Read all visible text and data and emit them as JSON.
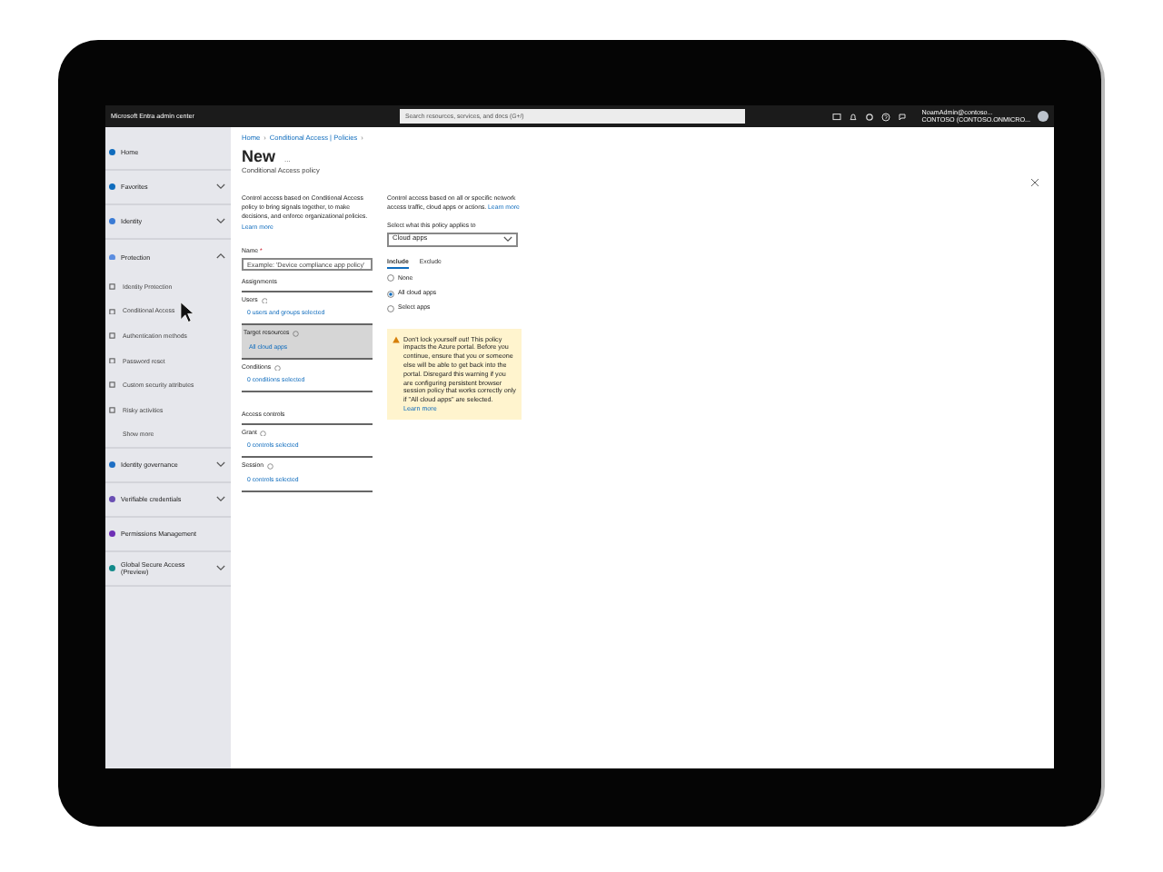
{
  "top_bar": {
    "title": "Microsoft Entra admin center",
    "search": {
      "placeholder": "Search resources, services, and docs (G+/)"
    },
    "user": {
      "name": "NoamAdmin@contoso...",
      "tenant": "CONTOSO (CONTOSO.ONMICRO..."
    }
  },
  "sidebar": {
    "items": [
      {
        "label": "Home",
        "kind": "link"
      },
      {
        "label": "Favorites",
        "kind": "group",
        "expanded": false
      },
      {
        "label": "Identity",
        "kind": "group",
        "expanded": false
      },
      {
        "label": "Protection",
        "kind": "group",
        "expanded": true,
        "children": [
          {
            "label": "Identity Protection",
            "kind": "link"
          },
          {
            "label": "Conditional Access",
            "kind": "link"
          },
          {
            "label": "Authentication methods",
            "kind": "link"
          },
          {
            "label": "Password reset",
            "kind": "link"
          },
          {
            "label": "Custom security attributes",
            "kind": "link"
          },
          {
            "label": "Risky activities",
            "kind": "link"
          },
          {
            "label": "Show more",
            "kind": "more"
          }
        ]
      },
      {
        "label": "Identity governance",
        "kind": "group",
        "expanded": false
      },
      {
        "label": "Verifiable credentials",
        "kind": "group",
        "expanded": false
      },
      {
        "label": "Permissions Management",
        "kind": "link"
      },
      {
        "label": "Global Secure Access (Preview)",
        "kind": "group",
        "expanded": false
      }
    ]
  },
  "breadcrumb": {
    "separator": "›",
    "items": [
      "Home",
      "Conditional Access | Policies"
    ]
  },
  "page": {
    "title": "New",
    "title_menu": "...",
    "subtitle": "Conditional Access policy"
  },
  "form": {
    "description": "Control access based on Conditional Access policy to bring signals together, to make decisions, and enforce organizational policies.",
    "learn_more": "Learn more",
    "name_field": {
      "label": "Name",
      "required_mark": "*",
      "placeholder": "Example: 'Device compliance app policy'"
    },
    "groups": [
      {
        "heading": "Assignments",
        "items": [
          {
            "label": "Users",
            "value": "0 users and groups selected",
            "selected": false
          },
          {
            "label": "Target resources",
            "value": "All cloud apps",
            "selected": true
          },
          {
            "label": "Conditions",
            "value": "0 conditions selected",
            "selected": false
          }
        ]
      },
      {
        "heading": "Access controls",
        "items": [
          {
            "label": "Grant",
            "value": "0 controls selected",
            "selected": false
          },
          {
            "label": "Session",
            "value": "0 controls selected",
            "selected": false
          }
        ]
      }
    ]
  },
  "target_panel": {
    "description": "Control access based on all or specific network access traffic, cloud apps or actions.",
    "learn_more": "Learn more",
    "applies_label": "Select what this policy applies to",
    "dropdown": {
      "value": "Cloud apps"
    },
    "tabs": [
      {
        "label": "Include",
        "selected": true
      },
      {
        "label": "Exclude",
        "selected": false
      }
    ],
    "options": [
      {
        "label": "None",
        "selected": false
      },
      {
        "label": "All cloud apps",
        "selected": true
      },
      {
        "label": "Select apps",
        "selected": false
      }
    ],
    "warning": {
      "text": "Don't lock yourself out! This policy impacts the Azure portal. Before you continue, ensure that you or someone else will be able to get back into the portal. Disregard this warning if you are configuring persistent browser session policy that works correctly only if \"All cloud apps\" are selected.",
      "learn_more": "Learn more"
    }
  }
}
